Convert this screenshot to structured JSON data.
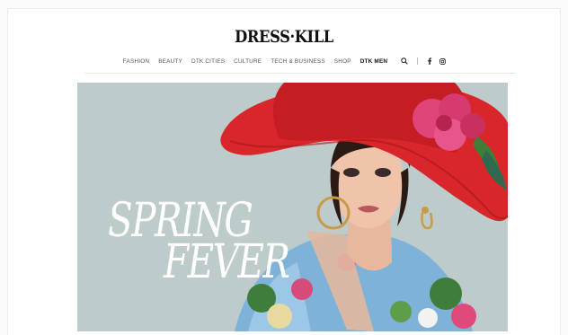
{
  "brand": {
    "logo_text": "DRESS·KILL"
  },
  "nav": {
    "items": [
      {
        "label": "FASHION"
      },
      {
        "label": "BEAUTY"
      },
      {
        "label": "DTK CITIES"
      },
      {
        "label": "CULTURE"
      },
      {
        "label": "TECH & BUSINESS"
      },
      {
        "label": "SHOP"
      },
      {
        "label": "DTK MEN"
      }
    ],
    "search_icon": "search-icon",
    "social": [
      "facebook-icon",
      "instagram-icon"
    ]
  },
  "hero": {
    "headline_line1": "SPRING",
    "headline_line2": "FEVER",
    "colors": {
      "background": "#b9c8c8",
      "hat": "#d8262b",
      "flower": "#e0457a"
    }
  }
}
